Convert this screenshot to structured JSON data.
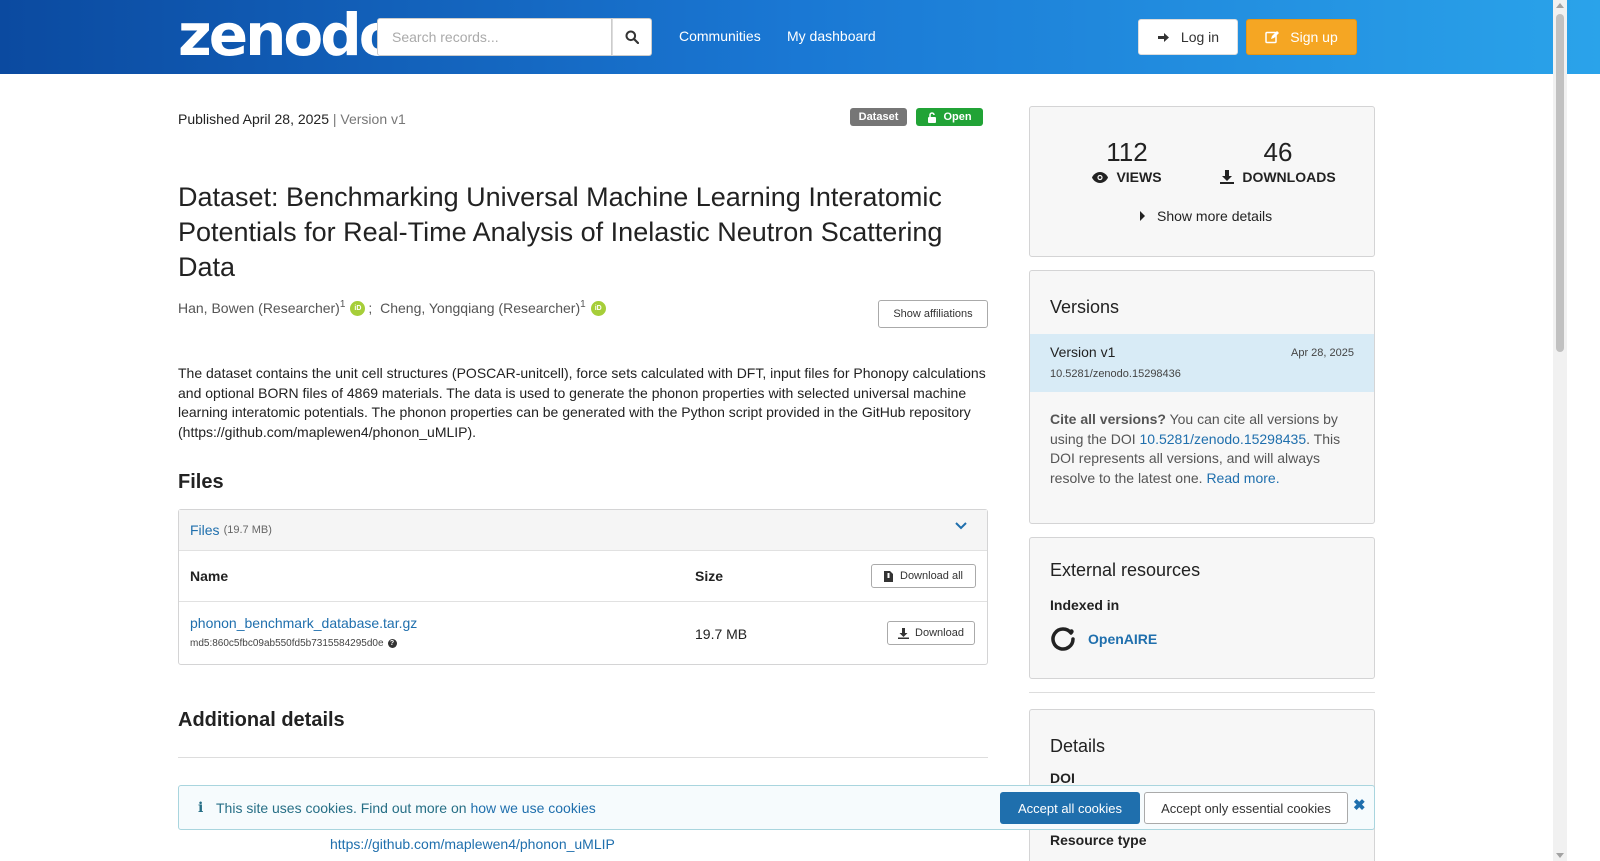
{
  "header": {
    "logo_text": "zenodo",
    "search": {
      "placeholder": "Search records...",
      "value": ""
    },
    "nav": [
      "Communities",
      "My dashboard"
    ],
    "login_label": "Log in",
    "signup_label": "Sign up",
    "gradient_colors": [
      "#0b4aa0",
      "#2aa3ea"
    ]
  },
  "record": {
    "published": "Published April 28, 2025",
    "version": "Version v1",
    "badges": {
      "type": "Dataset",
      "access": "Open"
    },
    "title": "Dataset: Benchmarking Universal Machine Learning Interatomic Potentials for Real-Time Analysis of Inelastic Neutron Scattering Data",
    "authors": [
      {
        "name": "Han, Bowen (Researcher)",
        "aff": "1"
      },
      {
        "name": "Cheng, Yongqiang (Researcher)",
        "aff": "1"
      }
    ],
    "show_affiliations": "Show affiliations",
    "description": "The dataset contains the unit cell structures (POSCAR-unitcell), force sets calculated with DFT, input files for Phonopy calculations and optional BORN files of 4869 materials. The data is used to generate the phonon properties with selected universal machine learning interatomic potentials. The phonon properties can be generated with the Python script provided in the GitHub repository (https://github.com/maplewen4/phonon_uMLIP)."
  },
  "files": {
    "heading": "Files",
    "panel_label": "Files",
    "panel_size": "(19.7 MB)",
    "col_name": "Name",
    "col_size": "Size",
    "download_all": "Download all",
    "items": [
      {
        "name": "phonon_benchmark_database.tar.gz",
        "md5": "md5:860c5fbc09ab550fd5b7315584295d0e",
        "size": "19.7 MB",
        "download": "Download"
      }
    ]
  },
  "additional": {
    "heading": "Additional details",
    "peek_link": "https://github.com/maplewen4/phonon_uMLIP"
  },
  "sidebar": {
    "stats": {
      "views": "112",
      "views_label": "VIEWS",
      "downloads": "46",
      "downloads_label": "DOWNLOADS",
      "more": "Show more details"
    },
    "versions": {
      "title": "Versions",
      "active": {
        "name": "Version v1",
        "date": "Apr 28, 2025",
        "doi": "10.5281/zenodo.15298436"
      },
      "cite_bold": "Cite all versions?",
      "cite_text_1": " You can cite all versions by using the DOI ",
      "cite_doi": "10.5281/zenodo.15298435",
      "cite_text_2": ". This DOI represents all versions, and will always resolve to the latest one. ",
      "read_more": "Read more."
    },
    "external": {
      "title": "External resources",
      "indexed_in": "Indexed in",
      "provider": "OpenAIRE"
    },
    "details": {
      "title": "Details",
      "doi_label": "DOI",
      "resource_label": "Resource type"
    }
  },
  "cookie": {
    "message": "This site uses cookies. Find out more on ",
    "link": "how we use cookies",
    "accept_all": "Accept all cookies",
    "accept_essential": "Accept only essential cookies"
  },
  "colors": {
    "accent": "#1f6fad",
    "open_badge": "#21a336",
    "signup": "#f5a623"
  }
}
